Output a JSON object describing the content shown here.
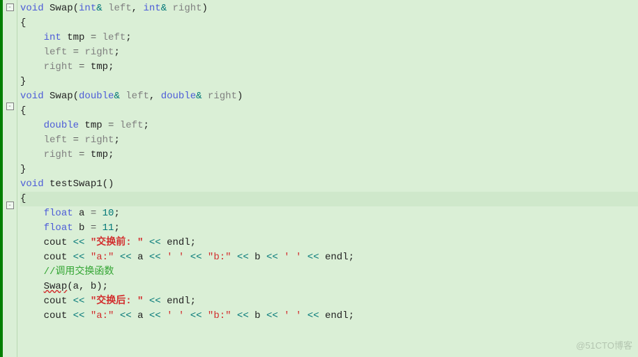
{
  "fold_symbol": "-",
  "fn1": {
    "kw_void": "void",
    "name": "Swap",
    "lp": "(",
    "int1": "int",
    "amp1": "& ",
    "p1": "left",
    "comma": ", ",
    "int2": "int",
    "amp2": "& ",
    "p2": "right",
    "rp": ")",
    "ob": "{",
    "l1_int": "int",
    "l1_tmp": " tmp ",
    "l1_eq": "= ",
    "l1_left": "left",
    "l1_sc": ";",
    "l2_left": "left",
    "l2_eq": " = ",
    "l2_right": "right",
    "l2_sc": ";",
    "l3_right": "right",
    "l3_eq": " = ",
    "l3_tmp": "tmp",
    "l3_sc": ";",
    "cb": "}"
  },
  "fn2": {
    "kw_void": "void",
    "name": "Swap",
    "lp": "(",
    "dbl1": "double",
    "amp1": "& ",
    "p1": "left",
    "comma": ", ",
    "dbl2": "double",
    "amp2": "& ",
    "p2": "right",
    "rp": ")",
    "ob": "{",
    "l1_dbl": "double",
    "l1_tmp": " tmp ",
    "l1_eq": "= ",
    "l1_left": "left",
    "l1_sc": ";",
    "l2_left": "left",
    "l2_eq": " = ",
    "l2_right": "right",
    "l2_sc": ";",
    "l3_right": "right",
    "l3_eq": " = ",
    "l3_tmp": "tmp",
    "l3_sc": ";",
    "cb": "}"
  },
  "fn3": {
    "kw_void": "void",
    "name": "testSwap1",
    "paren": "()",
    "ob": "{",
    "a_float": "float",
    "a_rest": " a ",
    "a_eq": "= ",
    "a_num": "10",
    "a_sc": ";",
    "b_float": "float",
    "b_rest": " b ",
    "b_eq": "= ",
    "b_num": "11",
    "b_sc": ";",
    "c1_cout": "cout ",
    "c1_op1": "<< ",
    "c1_str": "\"交换前: \"",
    "c1_op2": " << ",
    "c1_endl": "endl",
    "c1_sc": ";",
    "c2_cout": "cout ",
    "c2_op1": "<< ",
    "c2_s1": "\"a:\"",
    "c2_op2": " << ",
    "c2_a": "a ",
    "c2_op3": "<< ",
    "c2_sp1": "' '",
    "c2_op4": " << ",
    "c2_s2": "\"b:\"",
    "c2_op5": " << ",
    "c2_b": "b ",
    "c2_op6": "<< ",
    "c2_sp2": "' '",
    "c2_op7": " << ",
    "c2_endl": "endl",
    "c2_sc": ";",
    "comment": "//调用交换函数",
    "call_swap": "Swap",
    "call_args": "(a, b)",
    "call_sc": ";",
    "c3_cout": "cout ",
    "c3_op1": "<< ",
    "c3_str": "\"交换后: \"",
    "c3_op2": " << ",
    "c3_endl": "endl",
    "c3_sc": ";",
    "c4_cout": "cout ",
    "c4_op1": "<< ",
    "c4_s1": "\"a:\"",
    "c4_op2": " << ",
    "c4_a": "a ",
    "c4_op3": "<< ",
    "c4_sp1": "' '",
    "c4_op4": " << ",
    "c4_s2": "\"b:\"",
    "c4_op5": " << ",
    "c4_b": "b ",
    "c4_op6": "<< ",
    "c4_sp2": "' '",
    "c4_op7": " << ",
    "c4_endl": "endl",
    "c4_sc": ";"
  },
  "watermark": "@51CTO博客"
}
